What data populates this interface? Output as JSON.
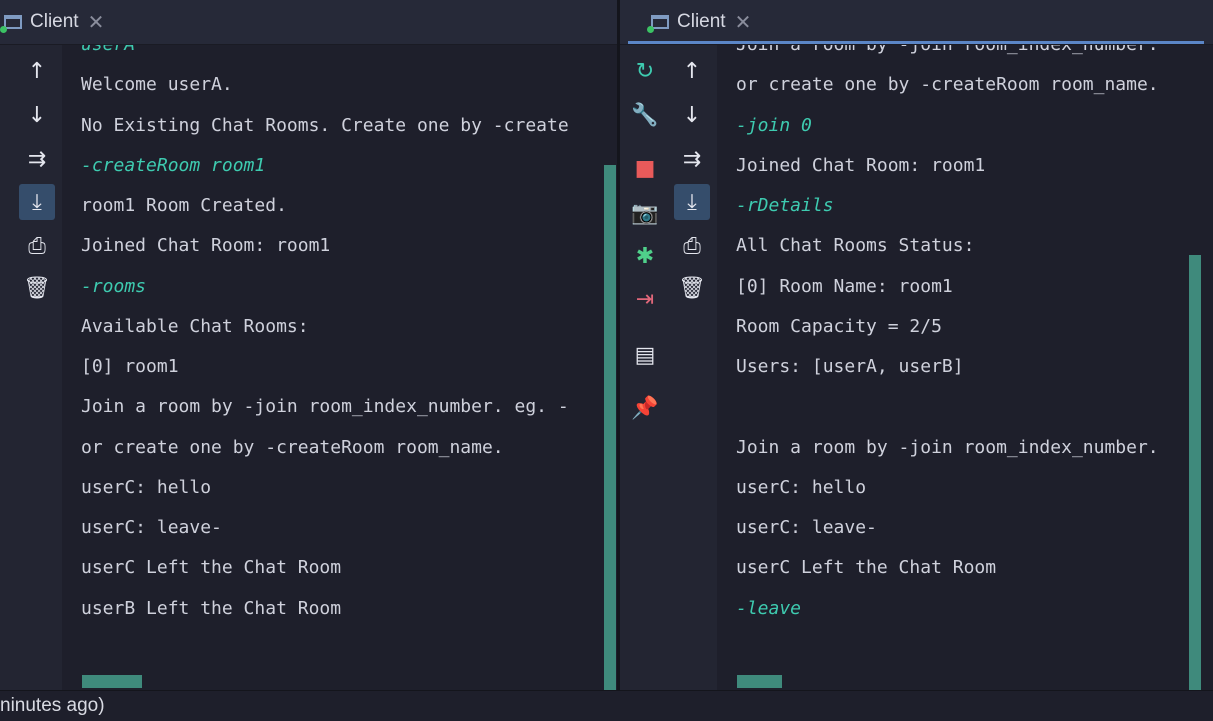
{
  "tabs": [
    {
      "label": "Client"
    },
    {
      "label": "Client"
    }
  ],
  "left_console": {
    "lines": [
      {
        "text": "userA",
        "cmd": true
      },
      {
        "text": "Welcome userA.",
        "cmd": false
      },
      {
        "text": "No Existing Chat Rooms. Create one by -create",
        "cmd": false
      },
      {
        "text": "-createRoom room1",
        "cmd": true
      },
      {
        "text": "room1 Room Created.",
        "cmd": false
      },
      {
        "text": "Joined Chat Room: room1",
        "cmd": false
      },
      {
        "text": "-rooms",
        "cmd": true
      },
      {
        "text": "Available Chat Rooms:",
        "cmd": false
      },
      {
        "text": "[0] room1",
        "cmd": false
      },
      {
        "text": "Join a room by -join room_index_number. eg. -",
        "cmd": false
      },
      {
        "text": "or create one by -createRoom room_name.",
        "cmd": false
      },
      {
        "text": "userC: hello",
        "cmd": false
      },
      {
        "text": "userC: leave-",
        "cmd": false
      },
      {
        "text": "userC Left the Chat Room",
        "cmd": false
      },
      {
        "text": "userB Left the Chat Room",
        "cmd": false
      }
    ]
  },
  "right_console": {
    "lines": [
      {
        "text": "Join a room by -join room_index_number.",
        "cmd": false
      },
      {
        "text": "or create one by -createRoom room_name.",
        "cmd": false
      },
      {
        "text": "-join 0",
        "cmd": true
      },
      {
        "text": "Joined Chat Room: room1",
        "cmd": false
      },
      {
        "text": "-rDetails",
        "cmd": true
      },
      {
        "text": "All Chat Rooms Status:",
        "cmd": false
      },
      {
        "text": "[0] Room Name: room1",
        "cmd": false
      },
      {
        "text": "Room Capacity = 2/5",
        "cmd": false
      },
      {
        "text": "Users: [userA, userB]",
        "cmd": false
      },
      {
        "text": "",
        "cmd": false
      },
      {
        "text": "Join a room by -join room_index_number.",
        "cmd": false
      },
      {
        "text": "userC: hello",
        "cmd": false
      },
      {
        "text": "userC: leave-",
        "cmd": false
      },
      {
        "text": "userC Left the Chat Room",
        "cmd": false
      },
      {
        "text": "-leave",
        "cmd": true
      }
    ]
  },
  "status": {
    "text": "ninutes ago)"
  },
  "colors": {
    "accent": "#3ecbb0",
    "scroll": "#3f8a7c",
    "background": "#1e1f2b"
  }
}
